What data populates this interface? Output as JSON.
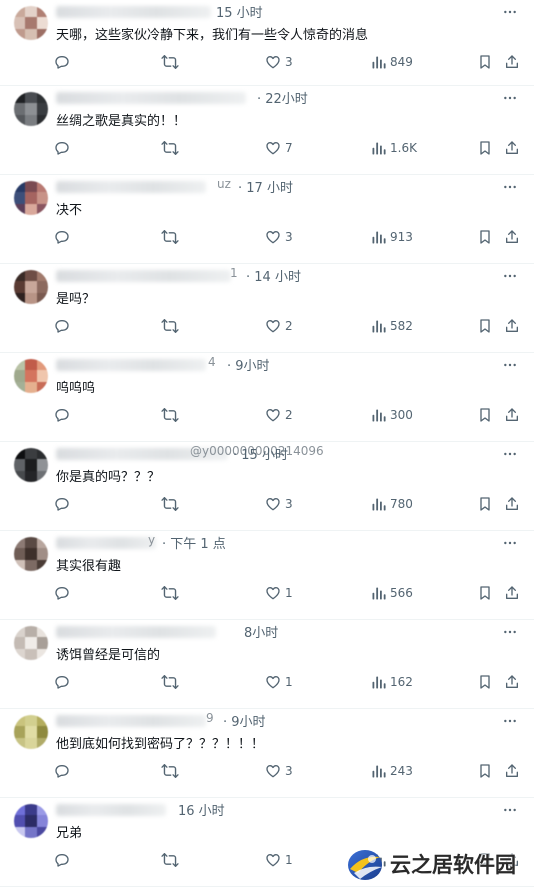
{
  "replies": [
    {
      "handle_tail": "",
      "time": "15 小时",
      "text": "天哪，这些家伙冷静下来，我们有一些令人惊奇的消息",
      "replies": "",
      "retweets": "",
      "likes": "3",
      "views": "849"
    },
    {
      "handle_tail": "",
      "time": "· 22小时",
      "text": "丝绸之歌是真实的！！",
      "replies": "",
      "retweets": "",
      "likes": "7",
      "views": "1.6K"
    },
    {
      "handle_tail": "uz",
      "time": "· 17 小时",
      "text": "决不",
      "replies": "",
      "retweets": "",
      "likes": "3",
      "views": "913"
    },
    {
      "handle_tail": "1",
      "time": "· 14 小时",
      "text": "是吗？",
      "replies": "",
      "retweets": "",
      "likes": "2",
      "views": "582"
    },
    {
      "handle_tail": "4",
      "time": "· 9小时",
      "text": "呜呜呜",
      "replies": "",
      "retweets": "",
      "likes": "2",
      "views": "300"
    },
    {
      "handle_tail": "@y000000000214096",
      "time": "· 15 小时",
      "text": "你是真的吗？？？",
      "replies": "",
      "retweets": "",
      "likes": "3",
      "views": "780"
    },
    {
      "handle_tail": "y",
      "time": "· 下午 1 点",
      "text": "其实很有趣",
      "replies": "",
      "retweets": "",
      "likes": "1",
      "views": "566"
    },
    {
      "handle_tail": "",
      "time": "8小时",
      "text": "诱饵曾经是可信的",
      "replies": "",
      "retweets": "",
      "likes": "1",
      "views": "162"
    },
    {
      "handle_tail": "9",
      "time": "· 9小时",
      "text": "他到底如何找到密码了？？？！！！",
      "replies": "",
      "retweets": "",
      "likes": "3",
      "views": "243"
    },
    {
      "handle_tail": "",
      "time": "16 小时",
      "text": "兄弟",
      "replies": "",
      "retweets": "",
      "likes": "1",
      "views": ""
    }
  ],
  "icons": {
    "reply": "reply-icon",
    "retweet": "retweet-icon",
    "like": "like-icon",
    "views": "views-icon",
    "bookmark": "bookmark-icon",
    "share": "share-icon",
    "more": "more-icon"
  },
  "colors": {
    "icon": "#536471",
    "text": "#0f1419",
    "divider": "#eff3f4"
  },
  "watermark": {
    "text": "云之居软件园"
  }
}
